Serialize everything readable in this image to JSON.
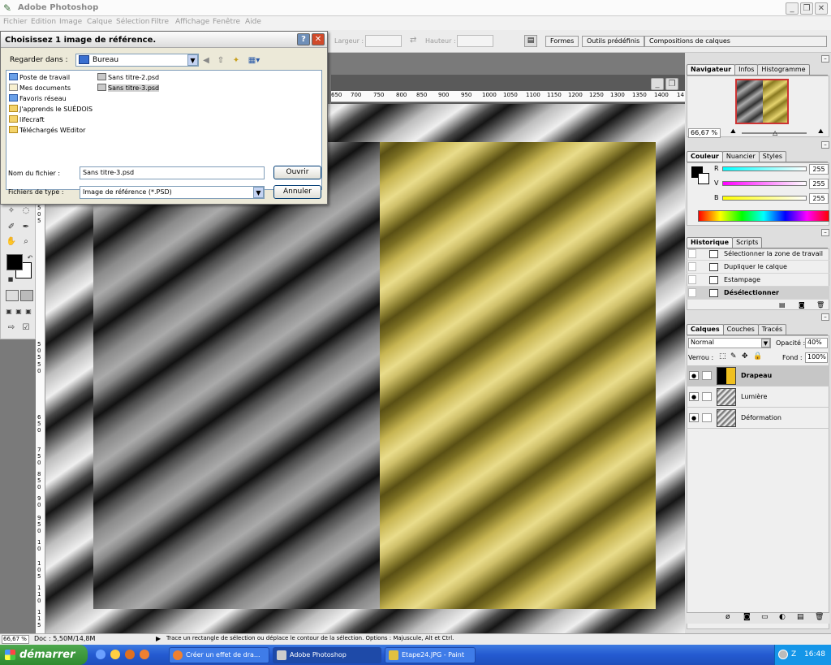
{
  "app": {
    "title": "Adobe Photoshop",
    "menus": [
      "Fichier",
      "Edition",
      "Image",
      "Calque",
      "Sélection",
      "Filtre",
      "Affichage",
      "Fenêtre",
      "Aide"
    ]
  },
  "options_bar": {
    "width_label": "Largeur :",
    "height_label": "Hauteur :",
    "wells": [
      "Formes",
      "Outils prédéfinis",
      "Compositions de calques"
    ]
  },
  "ruler": {
    "h_ticks": [
      "650",
      "700",
      "750",
      "800",
      "850",
      "900",
      "950",
      "1000",
      "1050",
      "1100",
      "1150",
      "1200",
      "1250",
      "1300",
      "1350",
      "1400",
      "14"
    ],
    "v_ticks": [
      "5",
      "0",
      "5",
      "5",
      "0",
      "5",
      "5",
      "0",
      "6",
      "5",
      "0",
      "7",
      "5",
      "0",
      "8",
      "5",
      "0",
      "9",
      "0",
      "9",
      "5",
      "0",
      "1",
      "0",
      "1",
      "0",
      "5",
      "1",
      "1",
      "0",
      "1",
      "1",
      "5"
    ]
  },
  "dialog": {
    "title": "Choisissez 1 image de référence.",
    "look_in_label": "Regarder dans :",
    "look_in_value": "Bureau",
    "files_col1": [
      {
        "name": "Poste de travail",
        "icon": "computer-icon"
      },
      {
        "name": "Mes documents",
        "icon": "documents-icon"
      },
      {
        "name": "Favoris réseau",
        "icon": "network-icon"
      },
      {
        "name": "J'apprends le SUÉDOIS",
        "icon": "folder-icon"
      },
      {
        "name": "lifecraft",
        "icon": "folder-icon"
      },
      {
        "name": "Téléchargés WEditor",
        "icon": "folder-icon"
      }
    ],
    "files_col2": [
      {
        "name": "Sans titre-2.psd",
        "icon": "psd-file-icon"
      },
      {
        "name": "Sans titre-3.psd",
        "icon": "psd-file-icon"
      }
    ],
    "filename_label": "Nom du fichier :",
    "filename_value": "Sans titre-3.psd",
    "filetype_label": "Fichiers de type :",
    "filetype_value": "Image de référence (*.PSD)",
    "open_label": "Ouvrir",
    "cancel_label": "Annuler"
  },
  "navigator": {
    "tabs": [
      "Navigateur",
      "Infos",
      "Histogramme"
    ],
    "zoom": "66,67 %"
  },
  "color": {
    "tabs": [
      "Couleur",
      "Nuancier",
      "Styles"
    ],
    "channels": [
      {
        "label": "R",
        "value": "255"
      },
      {
        "label": "V",
        "value": "255"
      },
      {
        "label": "B",
        "value": "255"
      }
    ]
  },
  "history": {
    "tabs": [
      "Historique",
      "Scripts"
    ],
    "items": [
      "Sélectionner la zone de travail",
      "Dupliquer le calque",
      "Estampage",
      "Désélectionner"
    ]
  },
  "layers": {
    "tabs": [
      "Calques",
      "Couches",
      "Tracés"
    ],
    "blend_mode": "Normal",
    "opacity_label": "Opacité :",
    "opacity_value": "40%",
    "lock_label": "Verrou :",
    "fill_label": "Fond :",
    "fill_value": "100%",
    "items": [
      "Drapeau",
      "Lumière",
      "Déformation"
    ]
  },
  "status": {
    "zoom": "66,67 %",
    "doc": "Doc : 5,50M/14,8M",
    "hint": "Trace un rectangle de sélection ou déplace le contour de la sélection. Options : Majuscule, Alt et Ctrl."
  },
  "taskbar": {
    "start_label": "démarrer",
    "tasks": [
      "Créer un effet de dra...",
      "Adobe Photoshop",
      "Etape24.JPG - Paint"
    ],
    "clock": "16:48"
  },
  "colors": {
    "flag_gold": "#c7b552",
    "xp_blue": "#245ad1",
    "start_green": "#2f8a2f"
  }
}
